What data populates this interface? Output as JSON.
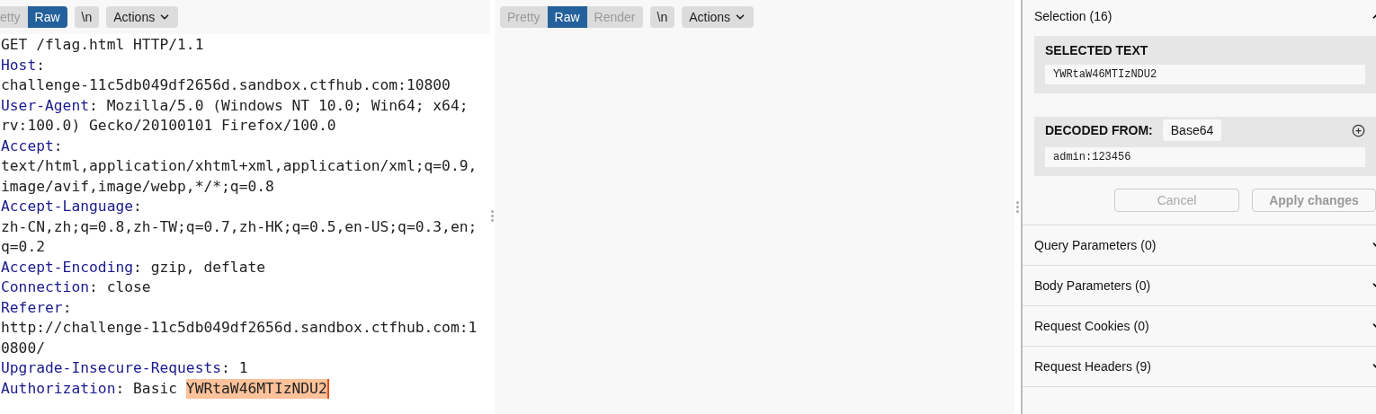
{
  "request_pane": {
    "view_tabs": [
      {
        "label": "etty",
        "selected": false
      },
      {
        "label": "Raw",
        "selected": true
      }
    ],
    "newline_button": "\\n",
    "actions_button": "Actions",
    "lines": [
      [
        {
          "kind": "plain",
          "text": "GET /flag.html HTTP/1.1"
        }
      ],
      [
        {
          "kind": "name",
          "text": "Host"
        },
        {
          "kind": "plain",
          "text": ":"
        }
      ],
      [
        {
          "kind": "plain",
          "text": "challenge-11c5db049df2656d.sandbox.ctfhub.com:10800"
        }
      ],
      [
        {
          "kind": "name",
          "text": "User-Agent"
        },
        {
          "kind": "plain",
          "text": ": Mozilla/5.0 (Windows NT 10.0; Win64; x64;"
        }
      ],
      [
        {
          "kind": "plain",
          "text": "rv:100.0) Gecko/20100101 Firefox/100.0"
        }
      ],
      [
        {
          "kind": "name",
          "text": "Accept"
        },
        {
          "kind": "plain",
          "text": ":"
        }
      ],
      [
        {
          "kind": "plain",
          "text": "text/html,application/xhtml+xml,application/xml;q=0.9,"
        }
      ],
      [
        {
          "kind": "plain",
          "text": "image/avif,image/webp,*/*;q=0.8"
        }
      ],
      [
        {
          "kind": "name",
          "text": "Accept-Language"
        },
        {
          "kind": "plain",
          "text": ":"
        }
      ],
      [
        {
          "kind": "plain",
          "text": "zh-CN,zh;q=0.8,zh-TW;q=0.7,zh-HK;q=0.5,en-US;q=0.3,en;"
        }
      ],
      [
        {
          "kind": "plain",
          "text": "q=0.2"
        }
      ],
      [
        {
          "kind": "name",
          "text": "Accept-Encoding"
        },
        {
          "kind": "plain",
          "text": ": gzip, deflate"
        }
      ],
      [
        {
          "kind": "name",
          "text": "Connection"
        },
        {
          "kind": "plain",
          "text": ": close"
        }
      ],
      [
        {
          "kind": "name",
          "text": "Referer"
        },
        {
          "kind": "plain",
          "text": ":"
        }
      ],
      [
        {
          "kind": "plain",
          "text": "http://challenge-11c5db049df2656d.sandbox.ctfhub.com:1"
        }
      ],
      [
        {
          "kind": "plain",
          "text": "0800/"
        }
      ],
      [
        {
          "kind": "name",
          "text": "Upgrade-Insecure-Requests"
        },
        {
          "kind": "plain",
          "text": ": 1"
        }
      ],
      [
        {
          "kind": "name",
          "text": "Authorization"
        },
        {
          "kind": "plain",
          "text": ": Basic "
        },
        {
          "kind": "selected",
          "text": "YWRtaW46MTIzNDU2"
        }
      ]
    ]
  },
  "response_pane": {
    "view_tabs": [
      {
        "label": "Pretty",
        "selected": false
      },
      {
        "label": "Raw",
        "selected": true
      },
      {
        "label": "Render",
        "selected": false
      }
    ],
    "newline_button": "\\n",
    "actions_button": "Actions"
  },
  "inspector": {
    "selection": {
      "title": "Selection (16)",
      "expanded": true,
      "selected_text_heading": "SELECTED TEXT",
      "selected_text": "YWRtaW46MTIzNDU2",
      "decoded_heading": "DECODED FROM:",
      "decoder": "Base64",
      "decoded_text": "admin:123456",
      "cancel": "Cancel",
      "apply": "Apply changes"
    },
    "sections": [
      {
        "title": "Query Parameters (0)",
        "expanded": false
      },
      {
        "title": "Body Parameters (0)",
        "expanded": false
      },
      {
        "title": "Request Cookies (0)",
        "expanded": false
      },
      {
        "title": "Request Headers (9)",
        "expanded": false
      }
    ]
  }
}
